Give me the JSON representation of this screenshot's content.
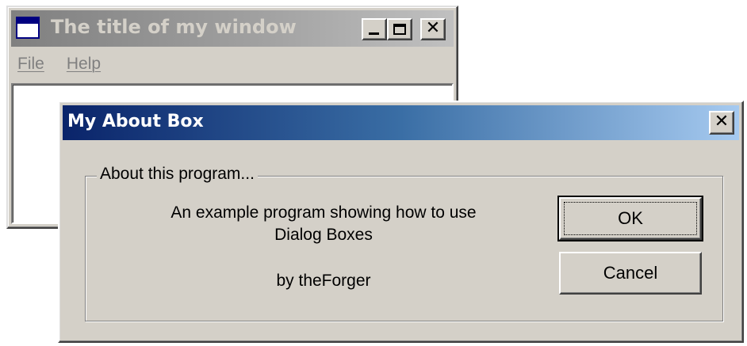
{
  "main_window": {
    "title": "The title of my window",
    "menu": [
      {
        "label": "File"
      },
      {
        "label": "Help"
      }
    ]
  },
  "about_dialog": {
    "title": "My About Box",
    "group_label": "About this program...",
    "description_lines": [
      "An example program showing how to use",
      "Dialog Boxes"
    ],
    "author": "by theForger",
    "ok_label": "OK",
    "cancel_label": "Cancel"
  },
  "colors": {
    "face": "#d4d0c8",
    "active_title_start": "#0a246a",
    "active_title_end": "#a6caf0",
    "inactive_title": "#808080"
  },
  "icons": {
    "app": "window-icon",
    "minimize": "minimize-icon",
    "maximize": "maximize-icon",
    "close": "close-icon"
  }
}
